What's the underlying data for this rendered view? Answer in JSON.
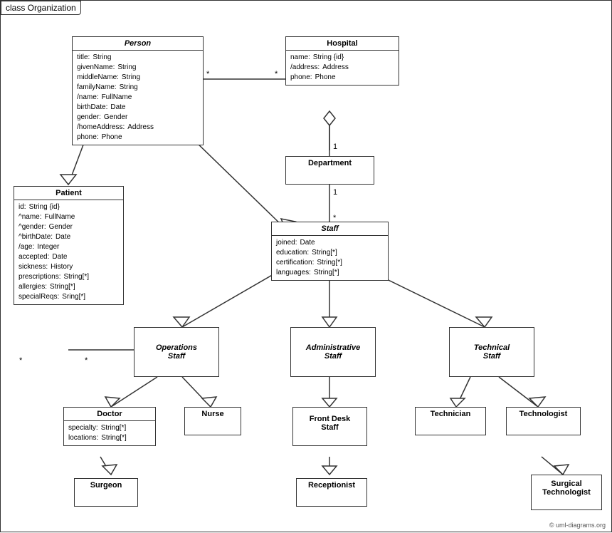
{
  "title": "class Organization",
  "classes": {
    "person": {
      "name": "Person",
      "italic": true,
      "attrs": [
        {
          "name": "title:",
          "type": "String"
        },
        {
          "name": "givenName:",
          "type": "String"
        },
        {
          "name": "middleName:",
          "type": "String"
        },
        {
          "name": "familyName:",
          "type": "String"
        },
        {
          "name": "/name:",
          "type": "FullName"
        },
        {
          "name": "birthDate:",
          "type": "Date"
        },
        {
          "name": "gender:",
          "type": "Gender"
        },
        {
          "name": "/homeAddress:",
          "type": "Address"
        },
        {
          "name": "phone:",
          "type": "Phone"
        }
      ]
    },
    "hospital": {
      "name": "Hospital",
      "italic": false,
      "attrs": [
        {
          "name": "name:",
          "type": "String {id}"
        },
        {
          "name": "/address:",
          "type": "Address"
        },
        {
          "name": "phone:",
          "type": "Phone"
        }
      ]
    },
    "department": {
      "name": "Department",
      "italic": false,
      "attrs": []
    },
    "staff": {
      "name": "Staff",
      "italic": true,
      "attrs": [
        {
          "name": "joined:",
          "type": "Date"
        },
        {
          "name": "education:",
          "type": "String[*]"
        },
        {
          "name": "certification:",
          "type": "String[*]"
        },
        {
          "name": "languages:",
          "type": "String[*]"
        }
      ]
    },
    "patient": {
      "name": "Patient",
      "italic": false,
      "attrs": [
        {
          "name": "id:",
          "type": "String {id}"
        },
        {
          "name": "^name:",
          "type": "FullName"
        },
        {
          "name": "^gender:",
          "type": "Gender"
        },
        {
          "name": "^birthDate:",
          "type": "Date"
        },
        {
          "name": "/age:",
          "type": "Integer"
        },
        {
          "name": "accepted:",
          "type": "Date"
        },
        {
          "name": "sickness:",
          "type": "History"
        },
        {
          "name": "prescriptions:",
          "type": "String[*]"
        },
        {
          "name": "allergies:",
          "type": "String[*]"
        },
        {
          "name": "specialReqs:",
          "type": "Sring[*]"
        }
      ]
    },
    "operationsStaff": {
      "name": "Operations\nStaff",
      "italic": true,
      "attrs": []
    },
    "administrativeStaff": {
      "name": "Administrative\nStaff",
      "italic": true,
      "attrs": []
    },
    "technicalStaff": {
      "name": "Technical\nStaff",
      "italic": true,
      "attrs": []
    },
    "doctor": {
      "name": "Doctor",
      "italic": false,
      "attrs": [
        {
          "name": "specialty:",
          "type": "String[*]"
        },
        {
          "name": "locations:",
          "type": "String[*]"
        }
      ]
    },
    "nurse": {
      "name": "Nurse",
      "italic": false,
      "attrs": []
    },
    "frontDeskStaff": {
      "name": "Front Desk\nStaff",
      "italic": false,
      "attrs": []
    },
    "technician": {
      "name": "Technician",
      "italic": false,
      "attrs": []
    },
    "technologist": {
      "name": "Technologist",
      "italic": false,
      "attrs": []
    },
    "surgeon": {
      "name": "Surgeon",
      "italic": false,
      "attrs": []
    },
    "receptionist": {
      "name": "Receptionist",
      "italic": false,
      "attrs": []
    },
    "surgicalTechnologist": {
      "name": "Surgical\nTechnologist",
      "italic": false,
      "attrs": []
    }
  },
  "copyright": "© uml-diagrams.org"
}
